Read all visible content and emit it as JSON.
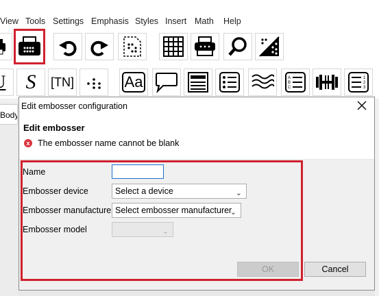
{
  "menubar": {
    "items": [
      "View",
      "Tools",
      "Settings",
      "Emphasis",
      "Styles",
      "Insert",
      "Math",
      "Help"
    ]
  },
  "toolbar1": {
    "icons": [
      "printer-icon",
      "embosser-icon",
      "undo-icon",
      "redo-icon",
      "braille-page-icon",
      "grid-icon",
      "embosser-device-icon",
      "search-icon",
      "translate-icon"
    ]
  },
  "toolbar2": {
    "underline_glyph": "U",
    "script_glyph": "S",
    "tn_label": "[TN]",
    "aa_label": "Aa",
    "icons": [
      "underline-icon",
      "script-icon",
      "transcriber-note-icon",
      "braille-dots-icon",
      "font-style-icon",
      "speech-bubble-icon",
      "heading-icon",
      "bullet-list-icon",
      "wave-icon",
      "abc-list-icon",
      "barbell-icon",
      "numbered-list-icon"
    ]
  },
  "background": {
    "body_tab": "Body"
  },
  "dialog": {
    "title": "Edit embosser configuration",
    "heading": "Edit embosser",
    "error_icon": "x",
    "error": "The embosser name cannot be blank",
    "fields": {
      "name_label": "Name",
      "name_value": "",
      "device_label": "Embosser device",
      "device_value": "Select a device",
      "manufacturer_label": "Embosser manufacturer",
      "manufacturer_value": "Select embosser manufacturer",
      "model_label": "Embosser model",
      "model_value": ""
    },
    "ok_label": "OK",
    "cancel_label": "Cancel"
  },
  "colors": {
    "highlight_red": "#d0202d",
    "error_red": "#d9363e",
    "focus_blue": "#1f6fd0"
  }
}
